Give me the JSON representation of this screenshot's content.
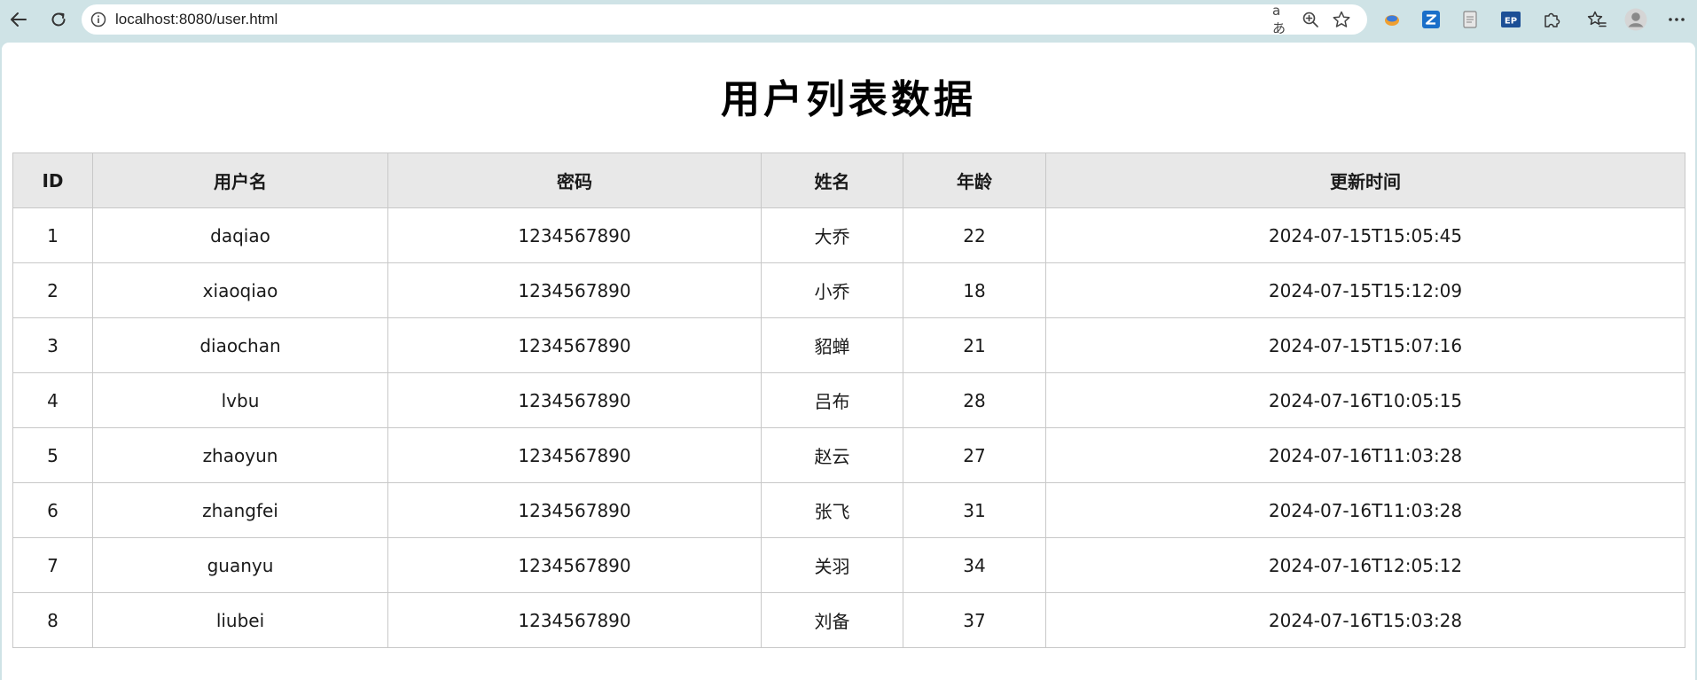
{
  "browser": {
    "url": "localhost:8080/user.html",
    "icons": {
      "back": "back-arrow-icon",
      "refresh": "refresh-icon",
      "info": "info-icon",
      "read_aloud": "read-aloud-icon",
      "zoom": "zoom-icon",
      "favorite": "star-icon",
      "extensions": [
        "firefox-style-extension-icon",
        "z-extension-icon",
        "page-extension-icon",
        "ep-extension-icon",
        "puzzle-icon"
      ],
      "favorites": "favorites-icon",
      "profile": "avatar",
      "menu": "more-icon"
    },
    "read_aloud_glyph": "aあ"
  },
  "page": {
    "title": "用户列表数据"
  },
  "table": {
    "headers": [
      "ID",
      "用户名",
      "密码",
      "姓名",
      "年龄",
      "更新时间"
    ],
    "rows": [
      [
        "1",
        "daqiao",
        "1234567890",
        "大乔",
        "22",
        "2024-07-15T15:05:45"
      ],
      [
        "2",
        "xiaoqiao",
        "1234567890",
        "小乔",
        "18",
        "2024-07-15T15:12:09"
      ],
      [
        "3",
        "diaochan",
        "1234567890",
        "貂蝉",
        "21",
        "2024-07-15T15:07:16"
      ],
      [
        "4",
        "lvbu",
        "1234567890",
        "吕布",
        "28",
        "2024-07-16T10:05:15"
      ],
      [
        "5",
        "zhaoyun",
        "1234567890",
        "赵云",
        "27",
        "2024-07-16T11:03:28"
      ],
      [
        "6",
        "zhangfei",
        "1234567890",
        "张飞",
        "31",
        "2024-07-16T11:03:28"
      ],
      [
        "7",
        "guanyu",
        "1234567890",
        "关羽",
        "34",
        "2024-07-16T12:05:12"
      ],
      [
        "8",
        "liubei",
        "1234567890",
        "刘备",
        "37",
        "2024-07-16T15:03:28"
      ]
    ]
  },
  "colors": {
    "chrome_background": "#cfe3e6",
    "header_background": "#e8e8e8",
    "border": "#c8c8c8"
  }
}
